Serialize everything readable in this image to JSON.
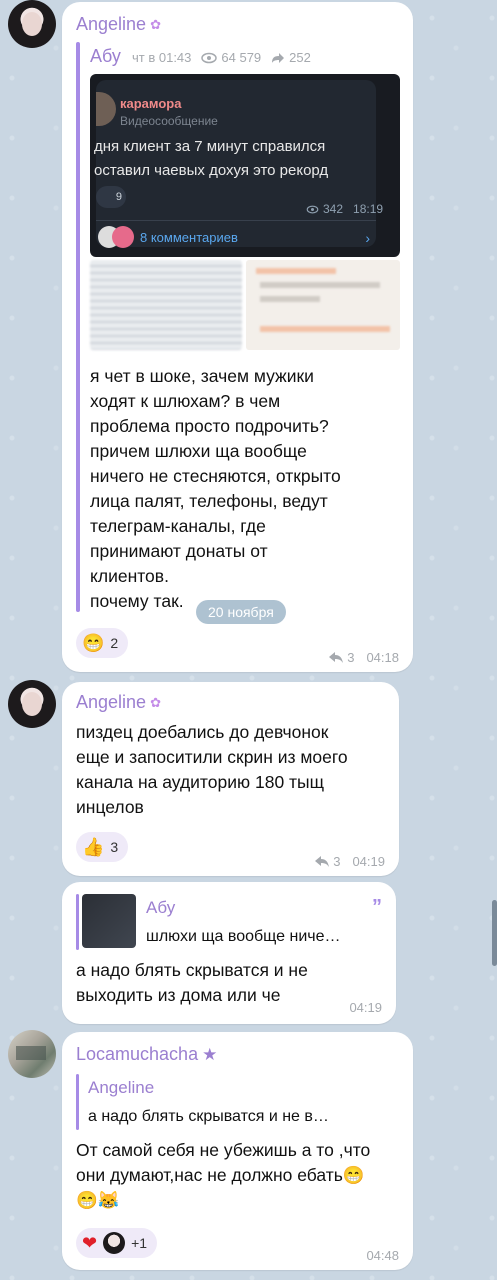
{
  "messages": [
    {
      "sender": "Angeline",
      "forward": {
        "from": "Абу",
        "date": "чт в 01:43",
        "views": "64 579",
        "shares": "252"
      },
      "screenshot": {
        "channel_name": "карамора",
        "subtitle": "Видеосообщение",
        "line1": "дня клиент за 7 минут справился",
        "line2": "оставил чаевых дохуя это рекорд",
        "count": "9",
        "views": "342",
        "time": "18:19",
        "comments": "8 комментариев"
      },
      "text": [
        "я чет в шоке, зачем мужики",
        "ходят к шлюхам? в чем",
        "проблема просто подрочить?",
        "причем шлюхи ща вообще",
        "ничего не стесняются, открыто",
        "лица палят, телефоны, ведут",
        "телеграм-каналы, где",
        "принимают донаты от",
        "клиентов.",
        "почему так."
      ],
      "reaction_count": "2",
      "reply_count": "3",
      "time": "04:18"
    },
    {
      "sender": "Angeline",
      "text": [
        "пиздец доебались до девчонок",
        "еще и запоситили скрин из моего",
        "канала на аудиторию 180 тыщ",
        "инцелов"
      ],
      "reaction_count": "3",
      "reply_count": "3",
      "time": "04:19"
    },
    {
      "reply_to": {
        "name": "Абу",
        "text": "шлюхи ща вообще ниче…"
      },
      "text": [
        "а надо блять скрыватся и не",
        "выходить из дома или че"
      ],
      "time": "04:19"
    },
    {
      "sender": "Locamuchacha",
      "reply_to": {
        "name": "Angeline",
        "text": "а надо блять скрыватся и не в…"
      },
      "text": [
        "От самой себя не убежишь а то ,что",
        "они думают,нас не должно ебать😁",
        "😁😹"
      ],
      "reaction_extra": "+1",
      "time": "04:48"
    }
  ],
  "date_pill": "20 ноября",
  "colors": {
    "accent": "#9b7fd0",
    "background": "#c9d6e2",
    "link": "#4aa3ff"
  }
}
